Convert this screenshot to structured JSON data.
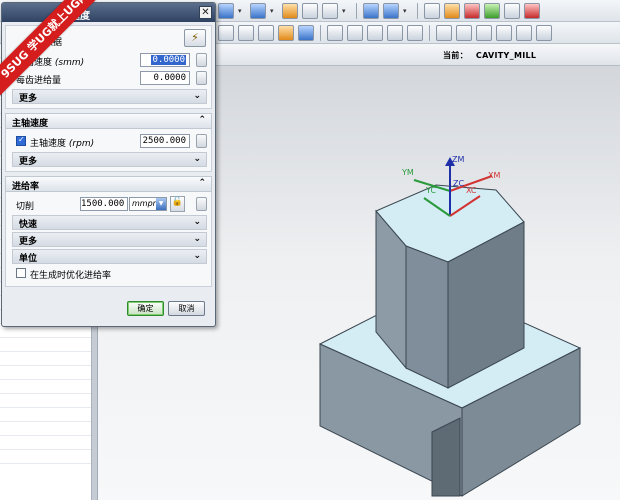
{
  "watermark": {
    "brand": "9SUG",
    "slogan": "学UG就上UG网"
  },
  "viewport": {
    "label": "当前：",
    "value": "CAVITY_MILL"
  },
  "dialog": {
    "title": "速度",
    "close_symbol": "✕",
    "section_gen": {
      "label": "加工数据",
      "surface_speed": {
        "label": "表面速度",
        "unit": "(smm)",
        "value": "0.0000"
      },
      "feed_per_tooth": {
        "label": "每齿进给量",
        "value": "0.0000"
      },
      "more": "更多"
    },
    "spindle": {
      "title": "主轴速度",
      "checked": true,
      "label": "主轴速度",
      "unit": "(rpm)",
      "value": "2500.000",
      "more": "更多"
    },
    "feed": {
      "title": "进给率",
      "cut_label": "切削",
      "cut_value": "1500.000",
      "cut_unit": "mmpr",
      "rapid": "快速",
      "more": "更多",
      "units": "单位",
      "optimize_checked": false,
      "optimize_label": "在生成时优化进给率"
    },
    "ok": "确定",
    "cancel": "取消"
  },
  "axes": {
    "zm": "ZM",
    "zc": "ZC",
    "ym": "YM",
    "yc": "YC",
    "xc": "XC",
    "xm": "XM"
  },
  "colors": {
    "title_bar": "#3a4d6c",
    "ok_border": "#2f8a2f",
    "model_top": "#d4ecf4",
    "model_side": "#7f8e9a",
    "model_dark": "#5e6b75"
  }
}
